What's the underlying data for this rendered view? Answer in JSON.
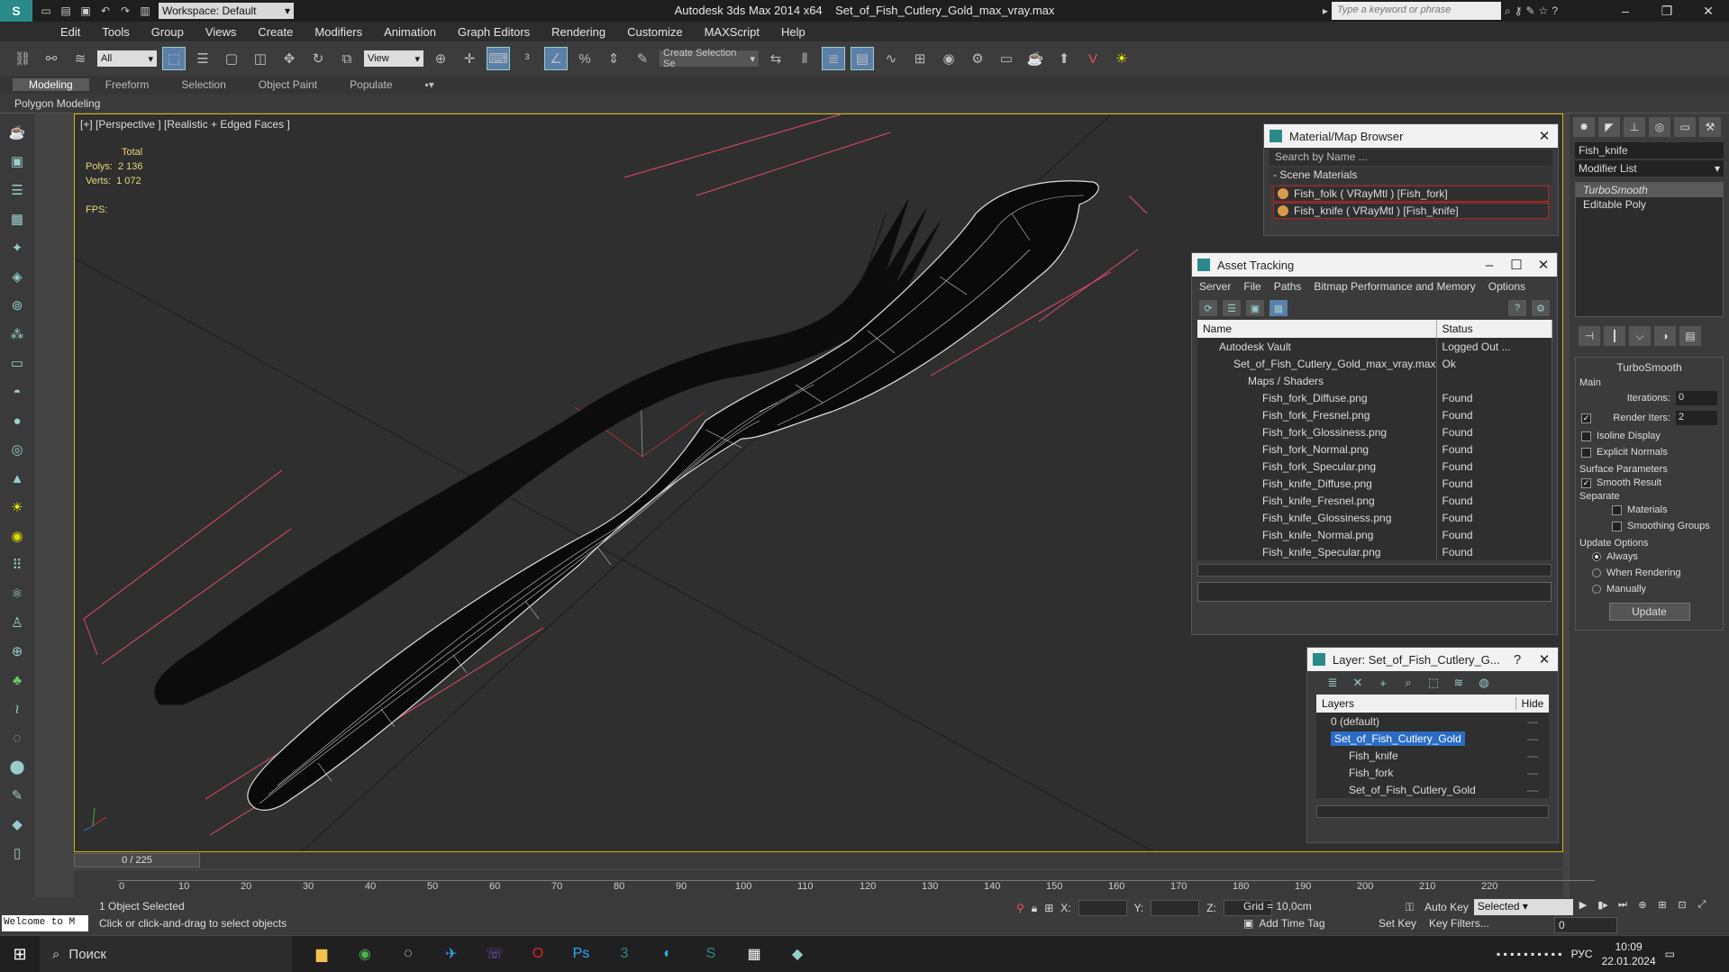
{
  "title": {
    "workspace": "Workspace: Default",
    "app": "Autodesk 3ds Max  2014 x64",
    "file": "Set_of_Fish_Cutlery_Gold_max_vray.max",
    "search_placeholder": "Type a keyword or phrase"
  },
  "menu": [
    "Edit",
    "Tools",
    "Group",
    "Views",
    "Create",
    "Modifiers",
    "Animation",
    "Graph Editors",
    "Rendering",
    "Customize",
    "MAXScript",
    "Help"
  ],
  "toolbar": {
    "filter": "All",
    "refcoord": "View",
    "selection_set": "Create Selection Se"
  },
  "ribbon": {
    "tabs": [
      "Modeling",
      "Freeform",
      "Selection",
      "Object Paint",
      "Populate"
    ],
    "sub": "Polygon Modeling"
  },
  "viewport": {
    "label": "[+] [Perspective ] [Realistic + Edged Faces ]",
    "stats_total": "Total",
    "polys_label": "Polys:",
    "polys": "2 136",
    "verts_label": "Verts:",
    "verts": "1 072",
    "fps_label": "FPS:"
  },
  "material_browser": {
    "title": "Material/Map Browser",
    "search": "Search by Name ...",
    "group": "- Scene Materials",
    "materials": [
      "Fish_folk  ( VRayMtl )  [Fish_fork]",
      "Fish_knife  ( VRayMtl )  [Fish_knife]"
    ]
  },
  "asset_tracking": {
    "title": "Asset Tracking",
    "menus": [
      "Server",
      "File",
      "Paths",
      "Bitmap Performance and Memory",
      "Options"
    ],
    "col_name": "Name",
    "col_status": "Status",
    "rows": [
      {
        "name": "Autodesk Vault",
        "status": "Logged Out ..."
      },
      {
        "name": "Set_of_Fish_Cutlery_Gold_max_vray.max",
        "status": "Ok"
      },
      {
        "name": "Maps / Shaders",
        "status": ""
      },
      {
        "name": "Fish_fork_Diffuse.png",
        "status": "Found"
      },
      {
        "name": "Fish_fork_Fresnel.png",
        "status": "Found"
      },
      {
        "name": "Fish_fork_Glossiness.png",
        "status": "Found"
      },
      {
        "name": "Fish_fork_Normal.png",
        "status": "Found"
      },
      {
        "name": "Fish_fork_Specular.png",
        "status": "Found"
      },
      {
        "name": "Fish_knife_Diffuse.png",
        "status": "Found"
      },
      {
        "name": "Fish_knife_Fresnel.png",
        "status": "Found"
      },
      {
        "name": "Fish_knife_Glossiness.png",
        "status": "Found"
      },
      {
        "name": "Fish_knife_Normal.png",
        "status": "Found"
      },
      {
        "name": "Fish_knife_Specular.png",
        "status": "Found"
      }
    ]
  },
  "layer_window": {
    "title": "Layer: Set_of_Fish_Cutlery_G...",
    "col_layers": "Layers",
    "col_hide": "Hide",
    "rows": [
      {
        "name": "0 (default)",
        "hide": "—"
      },
      {
        "name": "Set_of_Fish_Cutlery_Gold",
        "hide": "—"
      },
      {
        "name": "Fish_knife",
        "hide": "—"
      },
      {
        "name": "Fish_fork",
        "hide": "—"
      },
      {
        "name": "Set_of_Fish_Cutlery_Gold",
        "hide": "—"
      }
    ]
  },
  "command_panel": {
    "object_name": "Fish_knife",
    "modifier_list": "Modifier List",
    "stack": [
      "TurboSmooth",
      "Editable Poly"
    ],
    "rollout": "TurboSmooth",
    "main": "Main",
    "iterations_label": "Iterations:",
    "iterations": "0",
    "render_iters_label": "Render Iters:",
    "render_iters": "2",
    "isoline": "Isoline Display",
    "explicit": "Explicit Normals",
    "surface": "Surface Parameters",
    "smooth_result": "Smooth Result",
    "separate": "Separate",
    "materials": "Materials",
    "smoothing_groups": "Smoothing Groups",
    "update_options": "Update Options",
    "always": "Always",
    "when_rendering": "When Rendering",
    "manually": "Manually",
    "update_btn": "Update"
  },
  "timeline": {
    "frame": "0 / 225",
    "ticks": [
      "0",
      "10",
      "20",
      "30",
      "40",
      "50",
      "60",
      "70",
      "80",
      "90",
      "100",
      "110",
      "120",
      "130",
      "140",
      "150",
      "160",
      "170",
      "180",
      "190",
      "200",
      "210",
      "220"
    ]
  },
  "status": {
    "welcome": "Welcome to M",
    "selected": "1 Object Selected",
    "prompt": "Click or click-and-drag to select objects",
    "x": "X:",
    "y": "Y:",
    "z": "Z:",
    "grid": "Grid = 10,0cm",
    "add_time_tag": "Add Time Tag",
    "auto_key": "Auto Key",
    "selected_dd": "Selected",
    "set_key": "Set Key",
    "key_filters": "Key Filters...",
    "frame_value": "0"
  },
  "taskbar": {
    "search": "Поиск",
    "lang": "РУС",
    "time": "10:09",
    "date": "22.01.2024"
  }
}
